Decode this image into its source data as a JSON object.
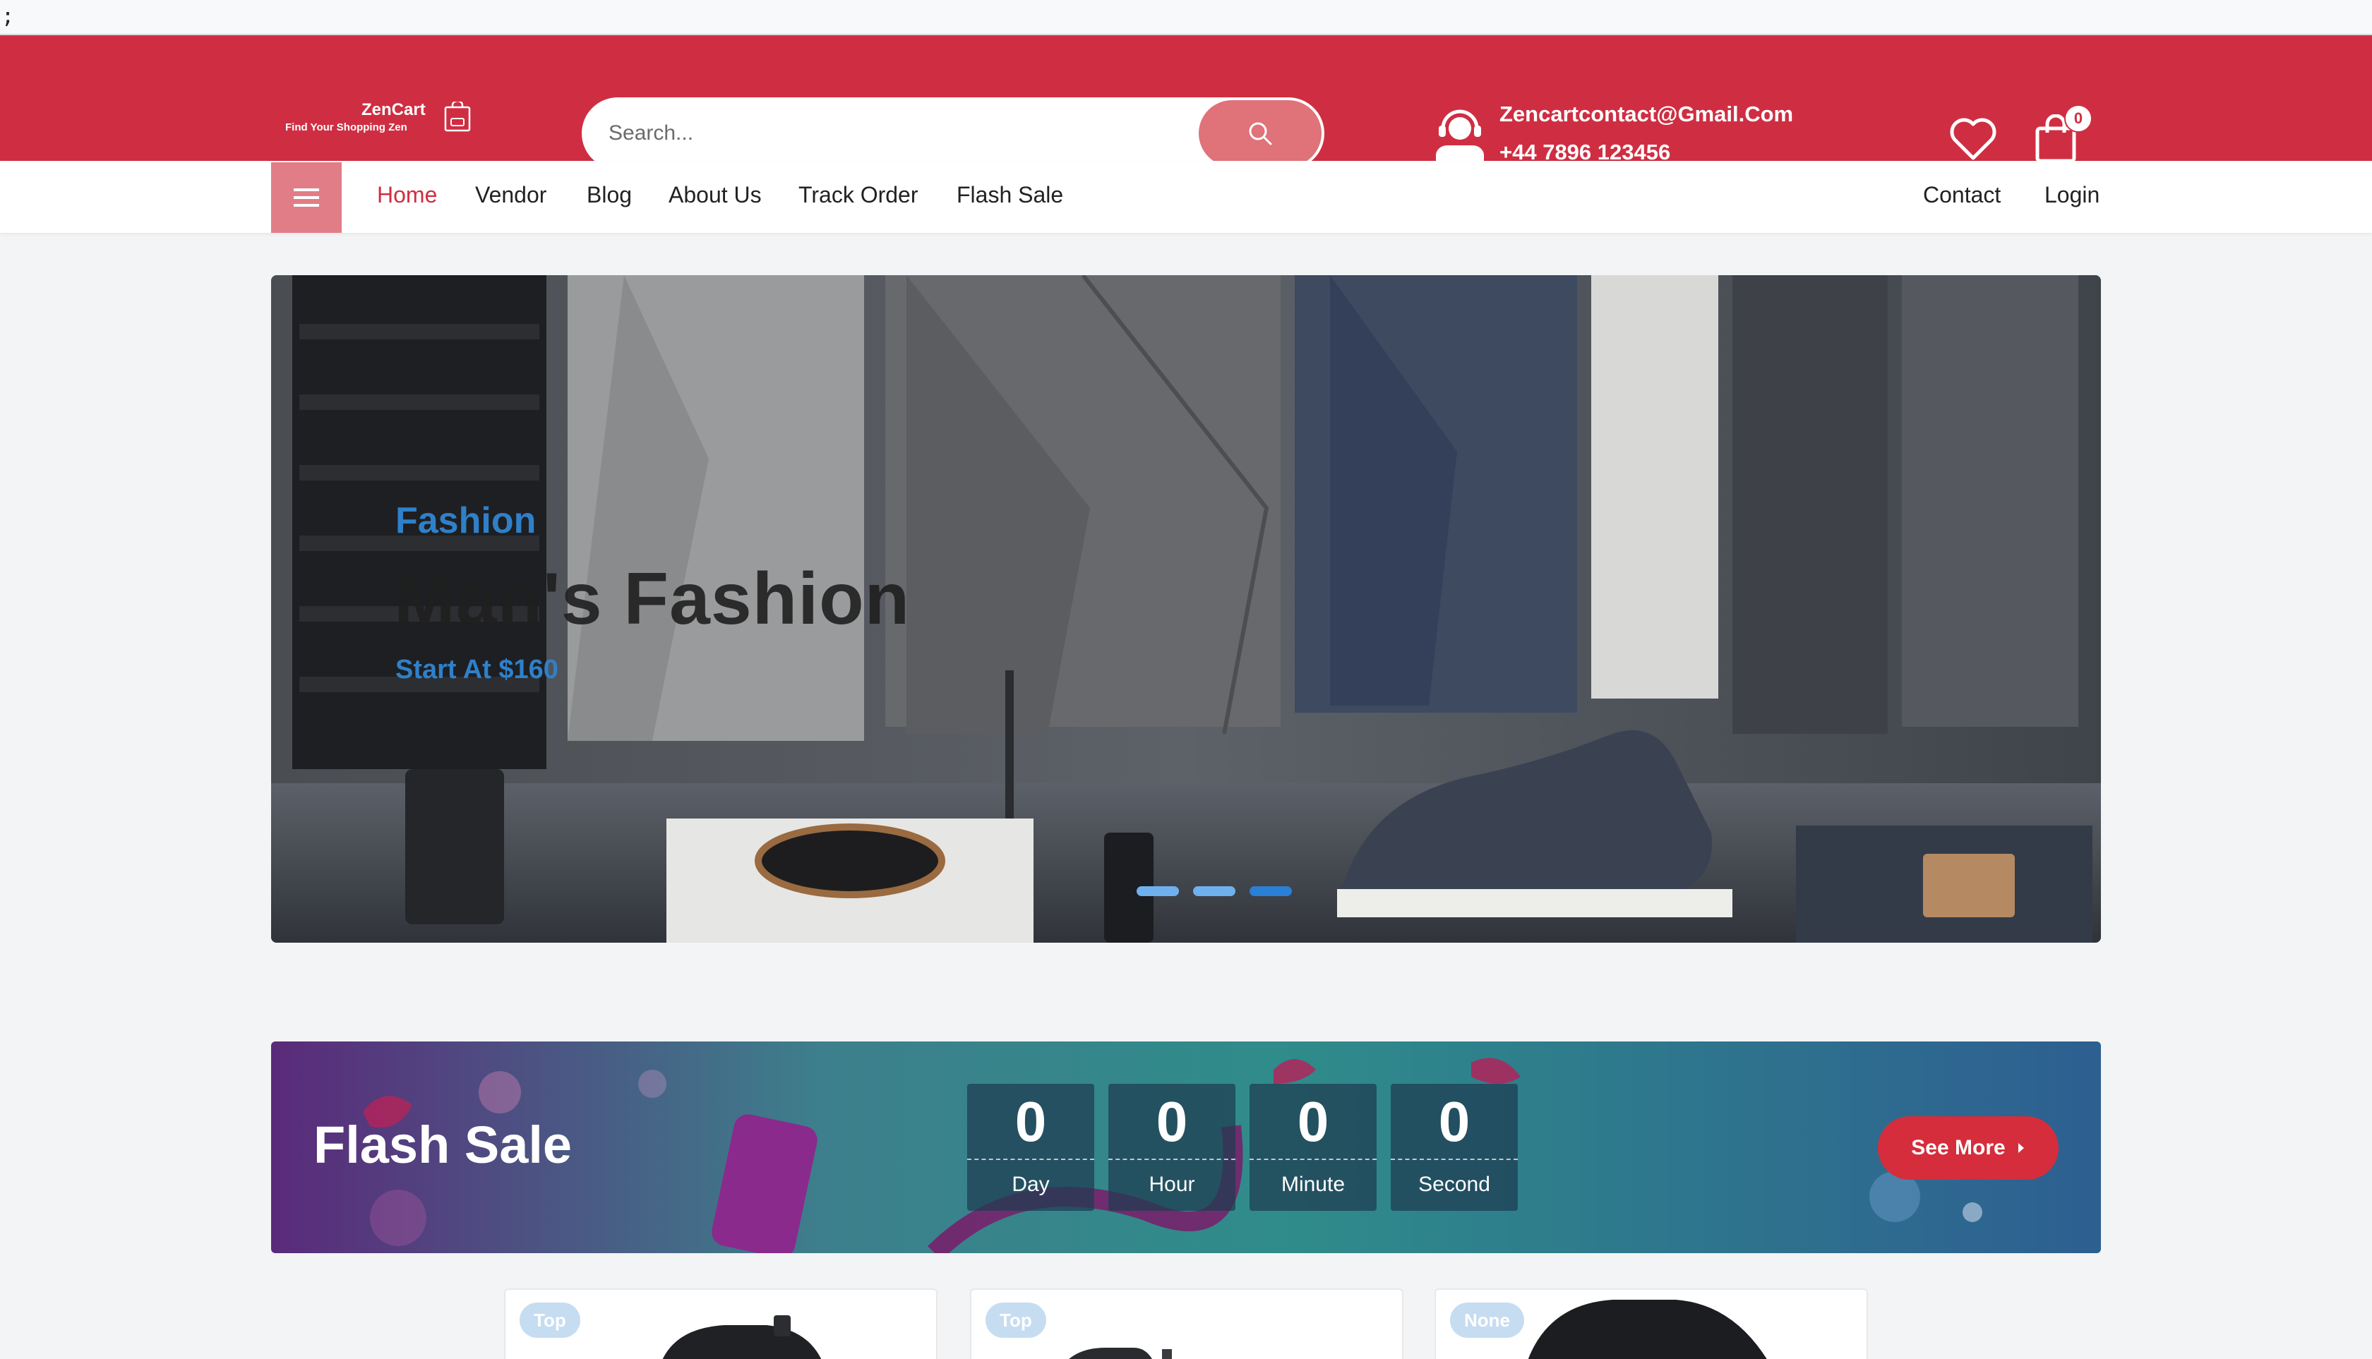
{
  "top_strip": {
    "text": ";"
  },
  "header": {
    "brand": "ZenCart",
    "tagline": "Find Your Shopping Zen",
    "search_placeholder": "Search...",
    "contact_email": "Zencartcontact@Gmail.Com",
    "contact_phone": "+44 7896 123456",
    "cart_count": "0",
    "colors": {
      "header_bg": "#cf2e42",
      "search_button": "#e0727a"
    },
    "icons": [
      "cart-logo-icon",
      "search-icon",
      "support-agent-icon",
      "heart-icon",
      "shopping-bag-icon"
    ]
  },
  "nav": {
    "menu_icon": "hamburger-icon",
    "items": [
      "Home",
      "Vendor",
      "Blog",
      "About Us",
      "Track Order",
      "Flash Sale"
    ],
    "right_items": [
      "Contact",
      "Login"
    ],
    "active": "Home"
  },
  "hero": {
    "subtitle": "Fashion",
    "title": "Man's Fashion",
    "price_text": "Start At $160",
    "slides": 3,
    "active_slide": 3
  },
  "flash_sale": {
    "title": "Flash Sale",
    "timer": [
      {
        "value": "0",
        "label": "Day"
      },
      {
        "value": "0",
        "label": "Hour"
      },
      {
        "value": "0",
        "label": "Minute"
      },
      {
        "value": "0",
        "label": "Second"
      }
    ],
    "see_more": "See More"
  },
  "products": [
    {
      "badge": "Top"
    },
    {
      "badge": "Top"
    },
    {
      "badge": "None"
    }
  ]
}
